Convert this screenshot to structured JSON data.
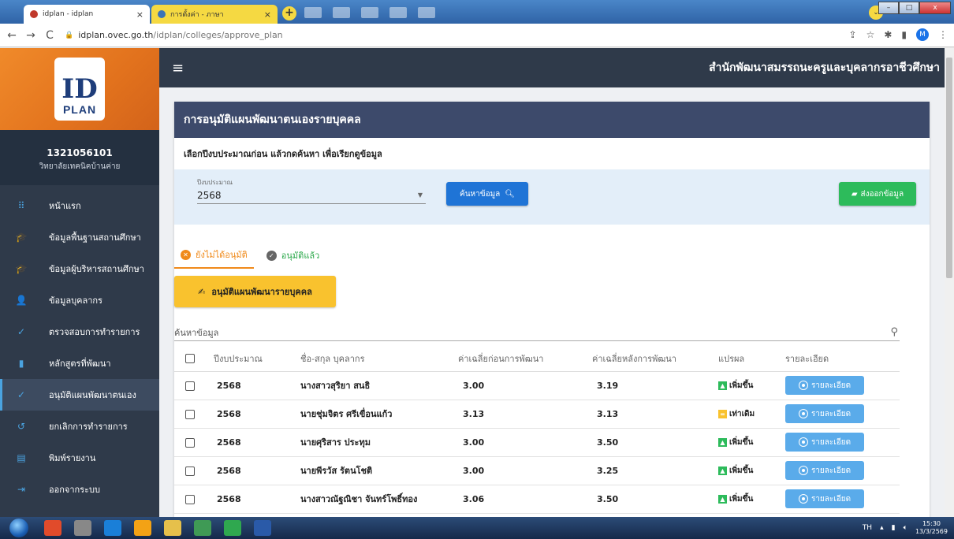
{
  "browser": {
    "tabs": [
      {
        "title": "idplan - idplan",
        "close": "×"
      },
      {
        "title": "การตั้งค่า - ภาษา",
        "close": "×"
      }
    ],
    "new_tab": "+",
    "url_host": "idplan.ovec.go.th",
    "url_path": "/idplan/colleges/approve_plan",
    "profile_initial": "M",
    "nav": {
      "back": "←",
      "forward": "→",
      "reload": "C"
    }
  },
  "sidebar": {
    "logo_text": "PLAN",
    "user_id": "1321056101",
    "college": "วิทยาลัยเทคนิคบ้านค่าย",
    "items": [
      {
        "label": "หน้าแรก",
        "icon": "grid-icon"
      },
      {
        "label": "ข้อมูลพื้นฐานสถานศึกษา",
        "icon": "school-icon"
      },
      {
        "label": "ข้อมูลผู้บริหารสถานศึกษา",
        "icon": "school-icon"
      },
      {
        "label": "ข้อมูลบุคลากร",
        "icon": "person-icon"
      },
      {
        "label": "ตรวจสอบการทำรายการ",
        "icon": "check-icon"
      },
      {
        "label": "หลักสูตรที่พัฒนา",
        "icon": "book-icon"
      },
      {
        "label": "อนุมัติแผนพัฒนาตนเอง",
        "icon": "check-icon",
        "active": true
      },
      {
        "label": "ยกเลิกการทำรายการ",
        "icon": "undo-icon"
      },
      {
        "label": "พิมพ์รายงาน",
        "icon": "table-icon"
      },
      {
        "label": "ออกจากระบบ",
        "icon": "logout-icon"
      }
    ]
  },
  "appbar": {
    "title": "สำนักพัฒนาสมรรถนะครูและบุคลากรอาชีวศึกษา"
  },
  "card": {
    "title": "การอนุมัติแผนพัฒนาตนเองรายบุคคล",
    "instruction": "เลือกปีงบประมาณก่อน แล้วกดค้นหา เพื่อเรียกดูข้อมูล",
    "fiscal_year_label": "ปีงบประมาณ",
    "fiscal_year_value": "2568",
    "search_button": "ค้นหาข้อมูล",
    "export_button": "ส่งออกข้อมูล",
    "tab_pending": "ยังไม่ได้อนุมัติ",
    "tab_approved": "อนุมัติแล้ว",
    "approve_button": "อนุมัติแผนพัฒนารายบุคคล",
    "search_placeholder": "ค้นหาข้อมูล"
  },
  "table": {
    "headers": [
      "ปีงบประมาณ",
      "ชื่อ-สกุล บุคลากร",
      "ค่าเฉลี่ยก่อนการพัฒนา",
      "ค่าเฉลี่ยหลังการพัฒนา",
      "แปรผล",
      "รายละเอียด"
    ],
    "detail_label": "รายละเอียด",
    "rows": [
      {
        "year": "2568",
        "name": "นางสาวสุริยา สนธิ",
        "before": "3.00",
        "after": "3.19",
        "result": "เพิ่มขึ้น",
        "result_type": "up"
      },
      {
        "year": "2568",
        "name": "นายชุ่มจิตร ศรีเขื่อนแก้ว",
        "before": "3.13",
        "after": "3.13",
        "result": "เท่าเดิม",
        "result_type": "same"
      },
      {
        "year": "2568",
        "name": "นายศุริสาร ประทุม",
        "before": "3.00",
        "after": "3.50",
        "result": "เพิ่มขึ้น",
        "result_type": "up"
      },
      {
        "year": "2568",
        "name": "นายพีรวัส รัตนโชติ",
        "before": "3.00",
        "after": "3.25",
        "result": "เพิ่มขึ้น",
        "result_type": "up"
      },
      {
        "year": "2568",
        "name": "นางสาวณัฐณิชา จันทร์โพธิ์ทอง",
        "before": "3.06",
        "after": "3.50",
        "result": "เพิ่มขึ้น",
        "result_type": "up"
      }
    ]
  },
  "taskbar": {
    "lang": "TH",
    "time": "15:30",
    "date": "13/3/2569"
  },
  "colors": {
    "sidebar_bg": "#2f3a4a",
    "header_bg": "#3d4a6b",
    "search_btn": "#1f74d6",
    "export_btn": "#2dbb5b",
    "approve_btn": "#f9c22e",
    "detail_btn": "#5aabea",
    "pending": "#f08a1a",
    "approved": "#2aa84a"
  }
}
